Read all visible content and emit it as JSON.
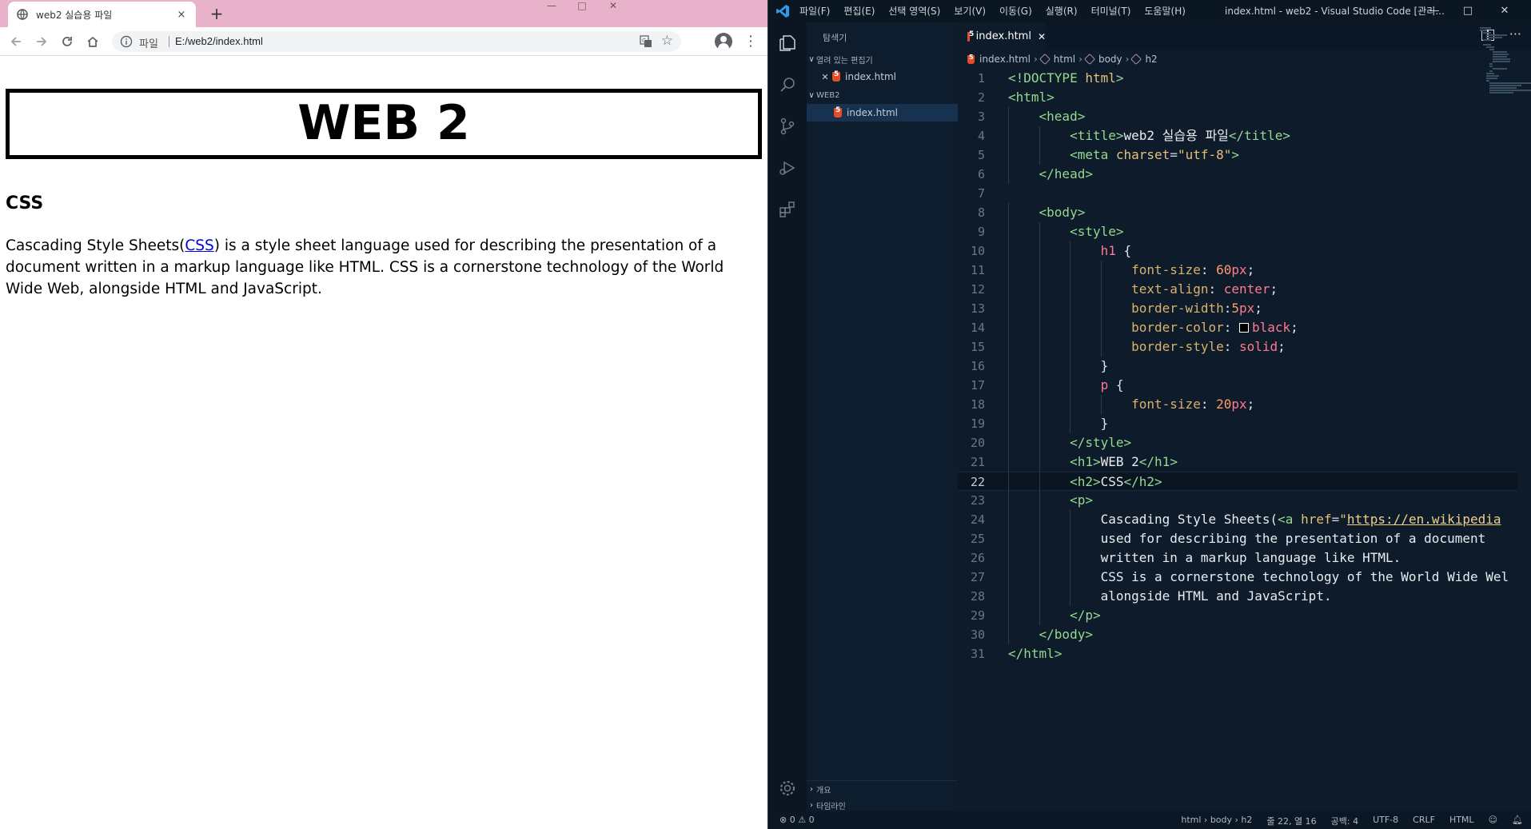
{
  "browser": {
    "tab_title": "web2 실습용 파일",
    "tab_close": "×",
    "new_tab": "+",
    "window_controls": [
      "—",
      "□",
      "✕"
    ],
    "scheme": "파일",
    "url": "E:/web2/index.html",
    "page": {
      "h1": "WEB 2",
      "h2": "CSS",
      "p_before": "Cascading Style Sheets(",
      "p_link": "CSS",
      "p_after": ") is a style sheet language used for describing the presentation of a document written in a markup language like HTML. CSS is a cornerstone technology of the World Wide Web, alongside HTML and JavaScript."
    }
  },
  "vscode": {
    "menu": [
      "파일(F)",
      "편집(E)",
      "선택 영역(S)",
      "보기(V)",
      "이동(G)",
      "실행(R)",
      "터미널(T)",
      "도움말(H)"
    ],
    "window_title": "index.html - web2 - Visual Studio Code [관리...",
    "window_controls": [
      "—",
      "□",
      "✕"
    ],
    "sidebar": {
      "header": "탐색기",
      "open_editors": "열려 있는 편집기",
      "open_file": "index.html",
      "folder": "WEB2",
      "folder_file": "index.html",
      "outline": "개요",
      "timeline": "타임라인"
    },
    "tab_label": "index.html",
    "breadcrumb": [
      "index.html",
      "html",
      "body",
      "h2"
    ],
    "code": [
      "<!DOCTYPE html>",
      "<html>",
      "    <head>",
      "        <title>web2 실습용 파일</title>",
      "        <meta charset=\"utf-8\">",
      "    </head>",
      "",
      "    <body>",
      "        <style>",
      "            h1 {",
      "                font-size: 60px;",
      "                text-align: center;",
      "                border-width:5px;",
      "                border-color: black;",
      "                border-style: solid;",
      "            }",
      "            p {",
      "                font-size: 20px;",
      "            }",
      "        </style>",
      "        <h1>WEB 2</h1>",
      "        <h2>CSS</h2>",
      "        <p>",
      "            Cascading Style Sheets(<a href=\"https://en.wikipedia",
      "            used for describing the presentation of a document",
      "            written in a markup language like HTML.",
      "            CSS is a cornerstone technology of the World Wide Wel",
      "            alongside HTML and JavaScript.",
      "        </p>",
      "    </body>",
      "</html>"
    ],
    "status": {
      "problems": "⊗ 0 ⚠ 0",
      "path": "html › body › h2",
      "position": "줄 22, 열 16",
      "spaces": "공백: 4",
      "encoding": "UTF-8",
      "eol": "CRLF",
      "language": "HTML"
    }
  }
}
